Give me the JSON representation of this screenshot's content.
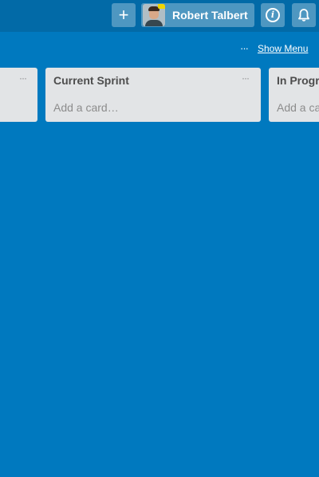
{
  "header": {
    "add_symbol": "+",
    "user_name": "Robert Talbert",
    "info_symbol": "i"
  },
  "board": {
    "dots": "···",
    "show_menu": "Show Menu"
  },
  "lists": [
    {
      "title": "",
      "menu": "···",
      "add_card": ""
    },
    {
      "title": "Current Sprint",
      "menu": "···",
      "add_card": "Add a card…"
    },
    {
      "title": "In Progress",
      "menu": "···",
      "add_card": "Add a card…"
    }
  ]
}
